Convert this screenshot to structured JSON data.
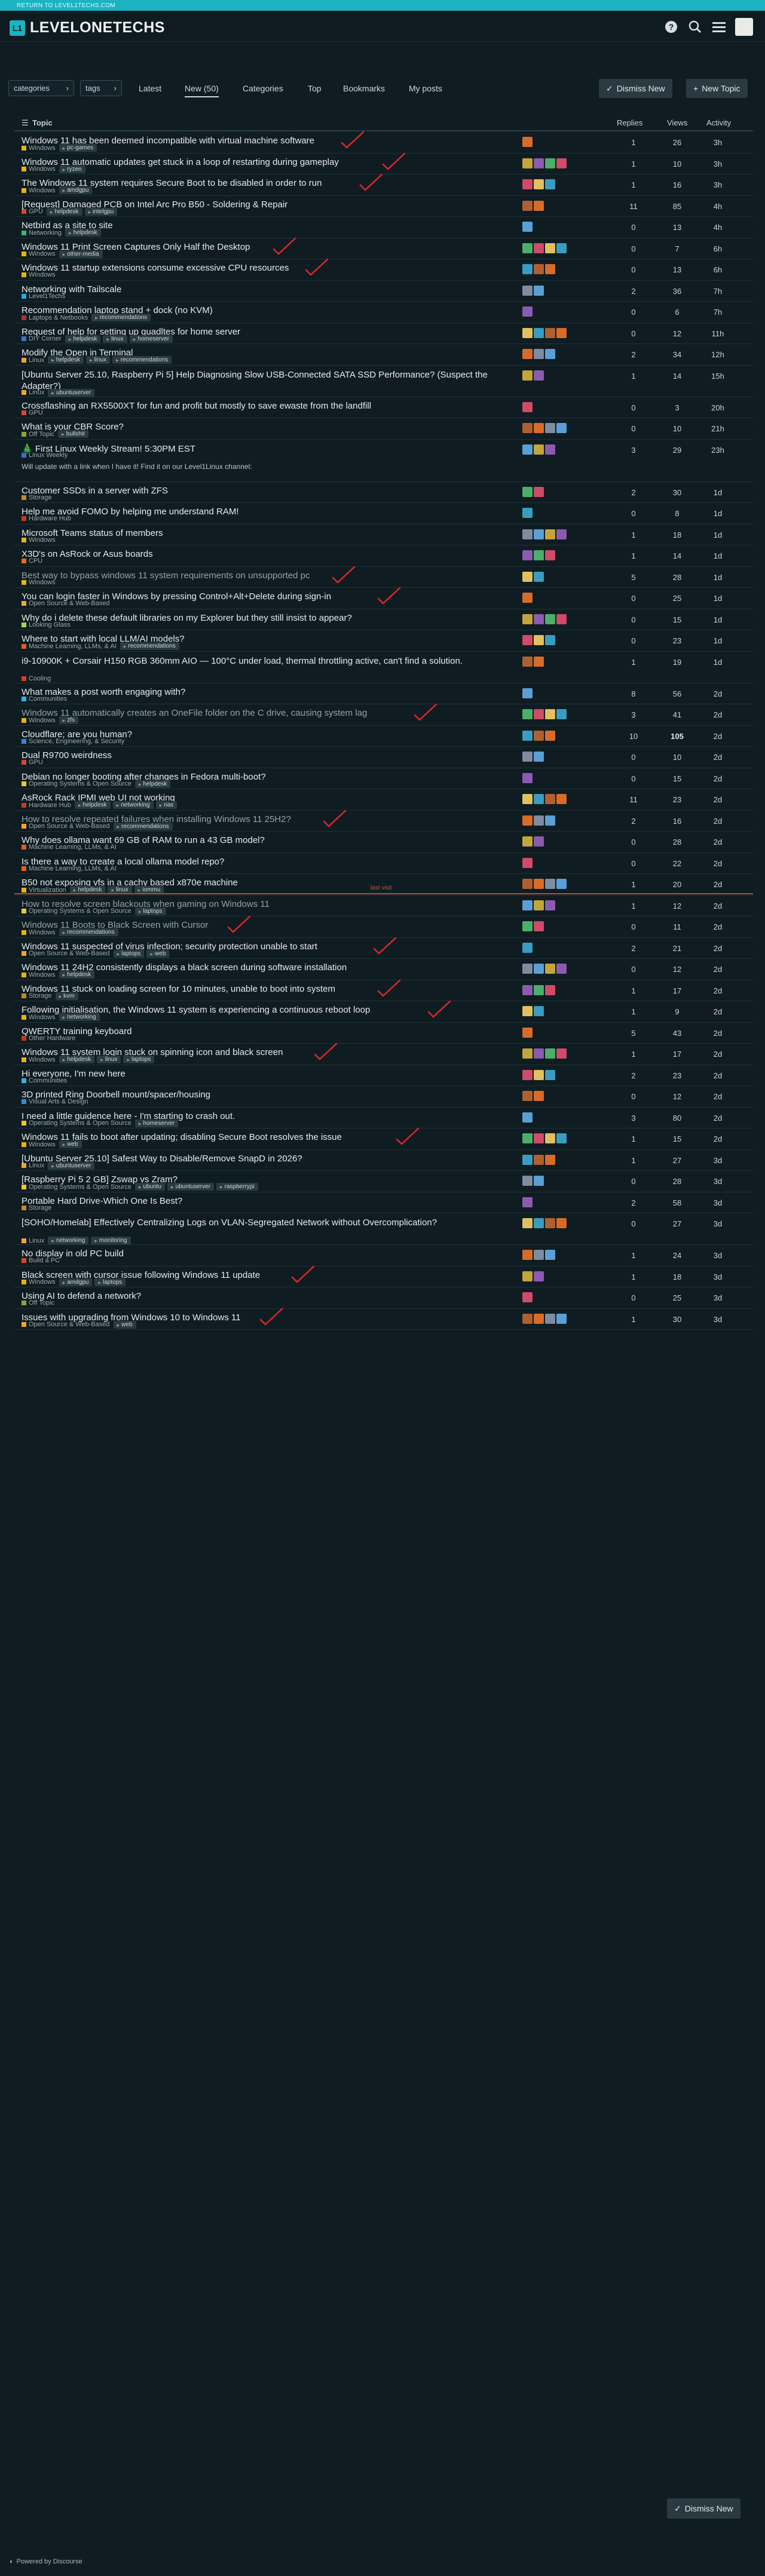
{
  "topbar": {
    "return_link": "RETURN TO LEVEL1TECHS.COM"
  },
  "header": {
    "logo_text": "LEVELONETECHS",
    "logo_mark": "L1",
    "icons": [
      "help-icon",
      "search-icon",
      "hamburger-icon"
    ]
  },
  "nav": {
    "categories": "categories",
    "tags": "tags",
    "links": [
      "Latest",
      "New (50)",
      "Categories",
      "Top",
      "Bookmarks",
      "My posts"
    ],
    "dismiss": "Dismiss New",
    "new_topic": "New Topic"
  },
  "list_header": {
    "topic": "Topic",
    "replies": "Replies",
    "views": "Views",
    "activity": "Activity"
  },
  "last_visit": "last visit",
  "topics": [
    {
      "title": "Windows 11 has been deemed incompatible with virtual machine software",
      "cat": "Windows",
      "tags": [
        "pc-games"
      ],
      "replies": "1",
      "views": "26",
      "activity": "3h",
      "check": true
    },
    {
      "title": "Windows 11 automatic updates get stuck in a loop of restarting during gameplay",
      "cat": "Windows",
      "tags": [
        "ryzen"
      ],
      "replies": "1",
      "views": "10",
      "activity": "3h",
      "check": true
    },
    {
      "title": "The Windows 11 system requires Secure Boot to be disabled in order to run",
      "cat": "Windows",
      "tags": [
        "amdgpu"
      ],
      "replies": "1",
      "views": "16",
      "activity": "3h",
      "check": true
    },
    {
      "title": "[Request] Damaged PCB on Intel Arc Pro B50 - Soldering & Repair",
      "cat": "GPU",
      "tags": [
        "helpdesk",
        "intelgpu"
      ],
      "replies": "11",
      "views": "85",
      "activity": "4h"
    },
    {
      "title": "Netbird as a site to site",
      "cat": "Networking",
      "tags": [
        "helpdesk"
      ],
      "replies": "0",
      "views": "13",
      "activity": "4h"
    },
    {
      "title": "Windows 11 Print Screen Captures Only Half the Desktop",
      "cat": "Windows",
      "tags": [
        "other-media"
      ],
      "replies": "0",
      "views": "7",
      "activity": "6h",
      "check": true
    },
    {
      "title": "Windows 11 startup extensions consume excessive CPU resources",
      "cat": "Windows",
      "tags": [],
      "replies": "0",
      "views": "13",
      "activity": "6h",
      "check": true
    },
    {
      "title": "Networking with Tailscale",
      "cat": "Level1Techs",
      "tags": [],
      "replies": "2",
      "views": "36",
      "activity": "7h"
    },
    {
      "title": "Recommendation laptop stand + dock (no KVM)",
      "cat": "Laptops & Netbooks",
      "tags": [
        "recommendations"
      ],
      "replies": "0",
      "views": "6",
      "activity": "7h"
    },
    {
      "title": "Request of help for setting up quadltes for home server",
      "cat": "DIY Corner",
      "tags": [
        "helpdesk",
        "linux",
        "homeserver"
      ],
      "replies": "0",
      "views": "12",
      "activity": "11h"
    },
    {
      "title": "Modify the Open in Terminal",
      "cat": "Linux",
      "tags": [
        "helpdesk",
        "linux",
        "recommendations"
      ],
      "replies": "2",
      "views": "34",
      "activity": "12h"
    },
    {
      "title": "[Ubuntu Server 25.10, Raspberry Pi 5] Help Diagnosing Slow USB-Connected SATA SSD Performance? (Suspect the Adapter?)",
      "cat": "Linux",
      "tags": [
        "ubuntuserver"
      ],
      "replies": "1",
      "views": "14",
      "activity": "15h",
      "tall": true
    },
    {
      "title": "Crossflashing an RX5500XT for fun and profit but mostly to save ewaste from the landfill",
      "cat": "GPU",
      "tags": [],
      "replies": "0",
      "views": "3",
      "activity": "20h"
    },
    {
      "title": "What is your CBR Score?",
      "cat": "Off Topic",
      "tags": [
        "bullshit"
      ],
      "replies": "0",
      "views": "10",
      "activity": "21h"
    },
    {
      "title": "🎄 First Linux Weekly Stream! 5:30PM EST",
      "cat": "Linux Weekly",
      "tags": [],
      "replies": "3",
      "views": "29",
      "activity": "23h",
      "excerpt": "Will update with a link when I have it! Find it on our Level1Linux channel:",
      "tall2": true
    },
    {
      "title": "Customer SSDs in a server with ZFS",
      "cat": "Storage",
      "tags": [],
      "replies": "2",
      "views": "30",
      "activity": "1d"
    },
    {
      "title": "Help me avoid FOMO by helping me understand RAM!",
      "cat": "Hardware Hub",
      "tags": [],
      "replies": "0",
      "views": "8",
      "activity": "1d"
    },
    {
      "title": "Microsoft Teams status of members",
      "cat": "Windows",
      "tags": [],
      "replies": "1",
      "views": "18",
      "activity": "1d"
    },
    {
      "title": "X3D's on AsRock or Asus boards",
      "cat": "CPU",
      "tags": [],
      "replies": "1",
      "views": "14",
      "activity": "1d"
    },
    {
      "title": "Best way to bypass windows 11 system requirements on unsupported pc",
      "cat": "Windows",
      "tags": [],
      "replies": "5",
      "views": "28",
      "activity": "1d",
      "visited": true,
      "check": true
    },
    {
      "title": "You can login faster in Windows by pressing Control+Alt+Delete during sign-in",
      "cat": "Open Source & Web-Based",
      "tags": [],
      "replies": "0",
      "views": "25",
      "activity": "1d",
      "check": true
    },
    {
      "title": "Why do i delete these default libraries on my Explorer but they still insist to appear?",
      "cat": "Looking Glass",
      "tags": [],
      "replies": "0",
      "views": "15",
      "activity": "1d"
    },
    {
      "title": "Where to start with local LLM/AI models?",
      "cat": "Machine Learning, LLMs, & AI",
      "tags": [
        "recommendations"
      ],
      "replies": "0",
      "views": "23",
      "activity": "1d"
    },
    {
      "title": "i9-10900K + Corsair H150 RGB 360mm AIO — 100°C under load, thermal throttling active, can't find a solution.",
      "cat": "Cooling",
      "tags": [],
      "replies": "1",
      "views": "19",
      "activity": "1d",
      "tall": true
    },
    {
      "title": "What makes a post worth engaging with?",
      "cat": "Communities",
      "tags": [],
      "replies": "8",
      "views": "56",
      "activity": "2d"
    },
    {
      "title": "Windows 11 automatically creates an OneFile folder on the C drive, causing system lag",
      "cat": "Windows",
      "tags": [
        "zfs"
      ],
      "replies": "3",
      "views": "41",
      "activity": "2d",
      "visited": true,
      "check": true
    },
    {
      "title": "Cloudflare; are you human?",
      "cat": "Science, Engineering, & Security",
      "tags": [],
      "replies": "10",
      "views": "105",
      "activity": "2d",
      "hot": true
    },
    {
      "title": "Dual R9700 weirdness",
      "cat": "GPU",
      "tags": [],
      "replies": "0",
      "views": "10",
      "activity": "2d"
    },
    {
      "title": "Debian no longer booting after changes in Fedora multi-boot?",
      "cat": "Operating Systems & Open Source",
      "tags": [
        "helpdesk"
      ],
      "replies": "0",
      "views": "15",
      "activity": "2d"
    },
    {
      "title": "AsRock Rack IPMI web UI not working",
      "cat": "Hardware Hub",
      "tags": [
        "helpdesk",
        "networking",
        "nas"
      ],
      "replies": "11",
      "views": "23",
      "activity": "2d"
    },
    {
      "title": "How to resolve repeated failures when installing Windows 11 25H2?",
      "cat": "Open Source & Web-Based",
      "tags": [
        "recommendations"
      ],
      "replies": "2",
      "views": "16",
      "activity": "2d",
      "visited": true,
      "check": true
    },
    {
      "title": "Why does ollama want 69 GB of RAM to run a 43 GB model?",
      "cat": "Machine Learning, LLMs, & AI",
      "tags": [],
      "replies": "0",
      "views": "28",
      "activity": "2d"
    },
    {
      "title": "Is there a way to create a local ollama model repo?",
      "cat": "Machine Learning, LLMs, & AI",
      "tags": [],
      "replies": "0",
      "views": "22",
      "activity": "2d"
    },
    {
      "title": "B50 not exposing vfs in a cachy based x870e machine",
      "cat": "Virtualization",
      "tags": [
        "helpdesk",
        "linux",
        "iommu"
      ],
      "replies": "1",
      "views": "20",
      "activity": "2d"
    },
    {
      "title": "How to resolve screen blackouts when gaming on Windows 11",
      "cat": "Operating Systems & Open Source",
      "tags": [
        "laptops"
      ],
      "replies": "1",
      "views": "12",
      "activity": "2d",
      "visited": true,
      "lastvisit": true
    },
    {
      "title": "Windows 11 Boots to Black Screen with Cursor",
      "cat": "Windows",
      "tags": [
        "recommendations"
      ],
      "replies": "0",
      "views": "11",
      "activity": "2d",
      "visited": true,
      "check": true
    },
    {
      "title": "Windows 11 suspected of virus infection; security protection unable to start",
      "cat": "Open Source & Web-Based",
      "tags": [
        "laptops",
        "web"
      ],
      "replies": "2",
      "views": "21",
      "activity": "2d",
      "check": true
    },
    {
      "title": "Windows 11 24H2 consistently displays a black screen during software installation",
      "cat": "Windows",
      "tags": [
        "helpdesk"
      ],
      "replies": "0",
      "views": "12",
      "activity": "2d"
    },
    {
      "title": "Windows 11 stuck on loading screen for 10 minutes, unable to boot into system",
      "cat": "Storage",
      "tags": [
        "kvm"
      ],
      "replies": "1",
      "views": "17",
      "activity": "2d",
      "check": true
    },
    {
      "title": "Following initialisation, the Windows 11 system is experiencing a continuous reboot loop",
      "cat": "Windows",
      "tags": [
        "networking"
      ],
      "replies": "1",
      "views": "9",
      "activity": "2d",
      "check": true
    },
    {
      "title": "QWERTY training keyboard",
      "cat": "Other Hardware",
      "tags": [],
      "replies": "5",
      "views": "43",
      "activity": "2d"
    },
    {
      "title": "Windows 11 system login stuck on spinning icon and black screen",
      "cat": "Windows",
      "tags": [
        "helpdesk",
        "linux",
        "laptops"
      ],
      "replies": "1",
      "views": "17",
      "activity": "2d",
      "check": true
    },
    {
      "title": "Hi everyone, I'm new here",
      "cat": "Communities",
      "tags": [],
      "replies": "2",
      "views": "23",
      "activity": "2d"
    },
    {
      "title": "3D printed Ring Doorbell mount/spacer/housing",
      "cat": "Visual Arts & Design",
      "tags": [],
      "replies": "0",
      "views": "12",
      "activity": "2d"
    },
    {
      "title": "I need a little guidence here - I'm starting to crash out.",
      "cat": "Operating Systems & Open Source",
      "tags": [
        "homeserver"
      ],
      "replies": "3",
      "views": "80",
      "activity": "2d"
    },
    {
      "title": "Windows 11 fails to boot after updating; disabling Secure Boot resolves the issue",
      "cat": "Windows",
      "tags": [
        "web"
      ],
      "replies": "1",
      "views": "15",
      "activity": "2d",
      "check": true
    },
    {
      "title": "[Ubuntu Server 25.10] Safest Way to Disable/Remove SnapD in 2026?",
      "cat": "Linux",
      "tags": [
        "ubuntuserver"
      ],
      "replies": "1",
      "views": "27",
      "activity": "3d"
    },
    {
      "title": "[Raspberry Pi 5 2 GB] Zswap vs Zram?",
      "cat": "Operating Systems & Open Source",
      "tags": [
        "ubuntu",
        "ubuntuserver",
        "raspberrypi"
      ],
      "replies": "0",
      "views": "28",
      "activity": "3d"
    },
    {
      "title": "Portable Hard Drive-Which One Is Best?",
      "cat": "Storage",
      "tags": [],
      "replies": "2",
      "views": "58",
      "activity": "3d"
    },
    {
      "title": "[SOHO/Homelab] Effectively Centralizing Logs on VLAN-Segregated Network without Overcomplication?",
      "cat": "Linux",
      "tags": [
        "networking",
        "monitoring"
      ],
      "replies": "0",
      "views": "27",
      "activity": "3d",
      "tall": true
    },
    {
      "title": "No display in old PC build",
      "cat": "Build a PC",
      "tags": [],
      "replies": "1",
      "views": "24",
      "activity": "3d"
    },
    {
      "title": "Black screen with cursor issue following Windows 11 update",
      "cat": "Windows",
      "tags": [
        "amdgpu",
        "laptops"
      ],
      "replies": "1",
      "views": "18",
      "activity": "3d",
      "check": true
    },
    {
      "title": "Using AI to defend a network?",
      "cat": "Off Topic",
      "tags": [],
      "replies": "0",
      "views": "25",
      "activity": "3d"
    },
    {
      "title": "Issues with upgrading from Windows 10 to Windows 11",
      "cat": "Open Source & Web-Based",
      "tags": [
        "web"
      ],
      "replies": "1",
      "views": "30",
      "activity": "3d",
      "check": true
    }
  ],
  "cat_colors": {
    "Windows": "#e7b416",
    "GPU": "#d04a32",
    "Networking": "#3cb371",
    "Level1Techs": "#25aae1",
    "Laptops & Netbooks": "#b82c2c",
    "DIY Corner": "#3a75c4",
    "Linux": "#f1a33b",
    "Off Topic": "#8ea23c",
    "Linux Weekly": "#3a6fc4",
    "Storage": "#bf8a2b",
    "Hardware Hub": "#c23a2a",
    "CPU": "#e46c1d",
    "Open Source & Web-Based": "#f0a830",
    "Looking Glass": "#a8d25e",
    "Machine Learning, LLMs, & AI": "#e25d2b",
    "Cooling": "#d23b2f",
    "Communities": "#3ab0d6",
    "Science, Engineering, & Security": "#3f80d8",
    "Operating Systems & Open Source": "#f0c52f",
    "Virtualization": "#f0b020",
    "Other Hardware": "#bf3a2a",
    "Visual Arts & Design": "#3f86d0",
    "Build a PC": "#d24a30"
  },
  "bottom": {
    "dismiss": "Dismiss New"
  },
  "footer": {
    "powered": "Powered by Discourse"
  }
}
